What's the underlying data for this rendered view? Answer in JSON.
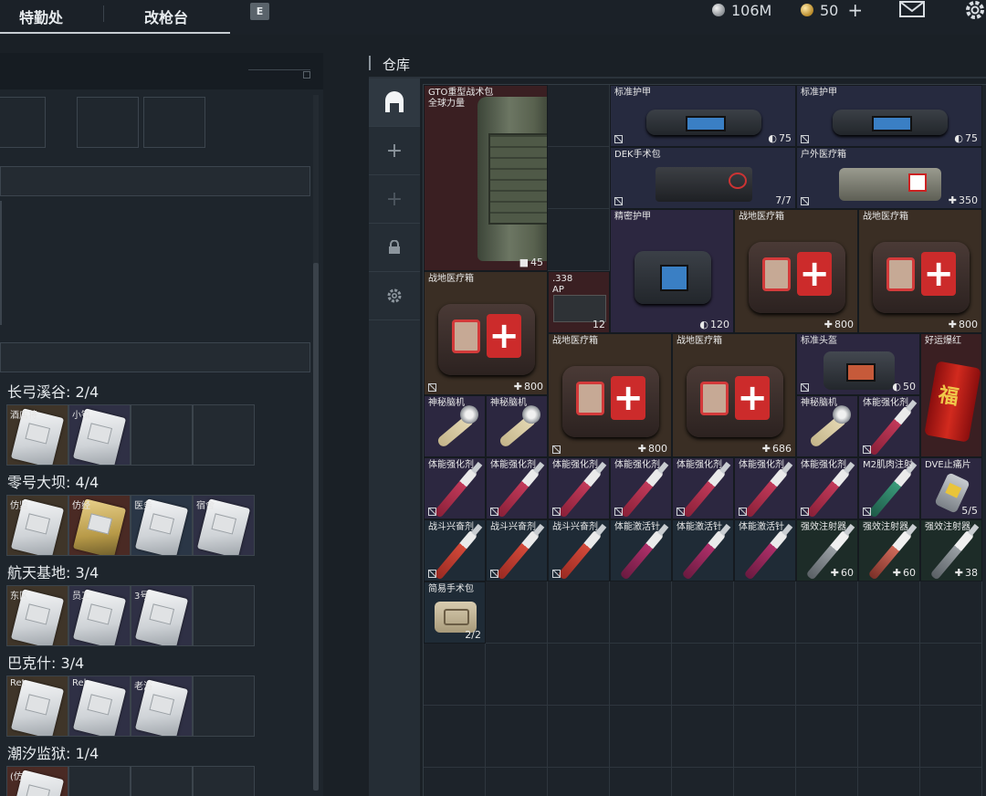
{
  "topbar": {
    "tabs": [
      "特勤处",
      "改枪台"
    ],
    "key_hint": "E",
    "silver_amount": "106M",
    "gold_amount": "50",
    "add_symbol": "+"
  },
  "left_panel": {
    "maps": [
      {
        "title": "长弓溪谷: 2/4",
        "cards": [
          {
            "label": "酒店将",
            "color": "brown",
            "owned": true
          },
          {
            "label": "小镇",
            "color": "purple",
            "owned": true
          },
          {
            "label": "",
            "color": "empty",
            "owned": false
          },
          {
            "label": "",
            "color": "empty",
            "owned": false
          }
        ]
      },
      {
        "title": "零号大坝: 4/4",
        "cards": [
          {
            "label": "仿监",
            "color": "brown",
            "owned": true
          },
          {
            "label": "仿经",
            "color": "red",
            "owned": true,
            "gold": true
          },
          {
            "label": "医务",
            "color": "blue",
            "owned": true
          },
          {
            "label": "宿舍",
            "color": "purple",
            "owned": true
          }
        ]
      },
      {
        "title": "航天基地: 3/4",
        "cards": [
          {
            "label": "东区",
            "color": "brown",
            "owned": true
          },
          {
            "label": "员工",
            "color": "purple",
            "owned": true
          },
          {
            "label": "3号",
            "color": "purple",
            "owned": true
          },
          {
            "label": "",
            "color": "empty",
            "owned": false
          }
        ]
      },
      {
        "title": "巴克什: 3/4",
        "cards": [
          {
            "label": "Ret",
            "color": "brown",
            "owned": true
          },
          {
            "label": "Rel",
            "color": "purple",
            "owned": true
          },
          {
            "label": "老浴",
            "color": "purple",
            "owned": true
          },
          {
            "label": "",
            "color": "empty",
            "owned": false
          }
        ]
      },
      {
        "title": "潮汐监狱: 1/4",
        "cards": [
          {
            "label": "(仿",
            "color": "red",
            "owned": true
          },
          {
            "label": "",
            "color": "empty",
            "owned": false
          },
          {
            "label": "",
            "color": "empty",
            "owned": false
          },
          {
            "label": "",
            "color": "empty",
            "owned": false
          }
        ]
      }
    ]
  },
  "warehouse": {
    "title": "仓库",
    "sidebar": [
      {
        "icon": "warehouse-icon",
        "symbol": ""
      },
      {
        "icon": "add-icon",
        "symbol": "+"
      },
      {
        "icon": "add-disabled-icon",
        "symbol": "+"
      },
      {
        "icon": "lock-icon",
        "symbol": ""
      },
      {
        "icon": "settings-icon",
        "symbol": ""
      }
    ],
    "items": [
      {
        "name": "GTO重型战术包\n全球力量",
        "value": "45",
        "sym": "bag",
        "color": "red",
        "art": "backpack",
        "c": 0,
        "r": 0,
        "w": 2,
        "h": 3
      },
      {
        "name": "标准护甲",
        "value": "75",
        "sym": "shield",
        "color": "blue",
        "art": "armor",
        "c": 3,
        "r": 0,
        "w": 3,
        "h": 1,
        "flag": true
      },
      {
        "name": "标准护甲",
        "value": "75",
        "sym": "shield",
        "color": "blue",
        "art": "armor",
        "c": 6,
        "r": 0,
        "w": 3,
        "h": 1,
        "flag": true
      },
      {
        "name": "DEK手术包",
        "value": "7/7",
        "sym": "",
        "color": "blue",
        "art": "dekkit",
        "c": 3,
        "r": 1,
        "w": 3,
        "h": 1,
        "flag": true
      },
      {
        "name": "户外医疗箱",
        "value": "350",
        "sym": "plus",
        "color": "blue",
        "art": "pouch",
        "c": 6,
        "r": 1,
        "w": 3,
        "h": 1,
        "flag": true
      },
      {
        "name": "精密护甲",
        "value": "120",
        "sym": "shield",
        "color": "purple",
        "art": "armor",
        "c": 3,
        "r": 2,
        "w": 2,
        "h": 2
      },
      {
        "name": "战地医疗箱",
        "value": "800",
        "sym": "plus",
        "color": "brown",
        "art": "medbox",
        "c": 5,
        "r": 2,
        "w": 2,
        "h": 2
      },
      {
        "name": "战地医疗箱",
        "value": "800",
        "sym": "plus",
        "color": "brown",
        "art": "medbox",
        "c": 7,
        "r": 2,
        "w": 2,
        "h": 2
      },
      {
        "name": "战地医疗箱",
        "value": "800",
        "sym": "plus",
        "color": "brown",
        "art": "medbox",
        "c": 0,
        "r": 3,
        "w": 2,
        "h": 2,
        "flag": true
      },
      {
        "name": ".338\nAP",
        "value": "12",
        "sym": "",
        "color": "red",
        "art": "ammo",
        "c": 2,
        "r": 3,
        "w": 1,
        "h": 1
      },
      {
        "name": "战地医疗箱",
        "value": "800",
        "sym": "plus",
        "color": "brown",
        "art": "medbox",
        "c": 2,
        "r": 4,
        "w": 2,
        "h": 2,
        "flag": true
      },
      {
        "name": "战地医疗箱",
        "value": "686",
        "sym": "plus",
        "color": "brown",
        "art": "medbox",
        "c": 4,
        "r": 4,
        "w": 2,
        "h": 2
      },
      {
        "name": "标准头盔",
        "value": "50",
        "sym": "shield",
        "color": "purple",
        "art": "helmetbag",
        "c": 6,
        "r": 4,
        "w": 2,
        "h": 1,
        "flag": true
      },
      {
        "name": "好运爆红",
        "value": "",
        "sym": "",
        "color": "red",
        "art": "firecracker",
        "c": 8,
        "r": 4,
        "w": 1,
        "h": 2
      },
      {
        "name": "神秘脑机",
        "value": "",
        "sym": "",
        "color": "purple",
        "art": "brainhook",
        "c": 0,
        "r": 5,
        "w": 1,
        "h": 1
      },
      {
        "name": "神秘脑机",
        "value": "",
        "sym": "",
        "color": "purple",
        "art": "brainhook",
        "c": 1,
        "r": 5,
        "w": 1,
        "h": 1
      },
      {
        "name": "神秘脑机",
        "value": "",
        "sym": "",
        "color": "purple",
        "art": "brainhook",
        "c": 6,
        "r": 5,
        "w": 1,
        "h": 1
      },
      {
        "name": "体能强化剂",
        "value": "",
        "sym": "",
        "color": "purple",
        "art": "syr-pink",
        "c": 7,
        "r": 5,
        "w": 1,
        "h": 1,
        "flag": true
      },
      {
        "name": "体能强化剂",
        "value": "",
        "sym": "",
        "color": "purple",
        "art": "syr-pink",
        "c": 0,
        "r": 6,
        "w": 1,
        "h": 1,
        "flag": true
      },
      {
        "name": "体能强化剂",
        "value": "",
        "sym": "",
        "color": "purple",
        "art": "syr-pink",
        "c": 1,
        "r": 6,
        "w": 1,
        "h": 1,
        "flag": true
      },
      {
        "name": "体能强化剂",
        "value": "",
        "sym": "",
        "color": "purple",
        "art": "syr-pink",
        "c": 2,
        "r": 6,
        "w": 1,
        "h": 1,
        "flag": true
      },
      {
        "name": "体能强化剂",
        "value": "",
        "sym": "",
        "color": "purple",
        "art": "syr-pink",
        "c": 3,
        "r": 6,
        "w": 1,
        "h": 1,
        "flag": true
      },
      {
        "name": "体能强化剂",
        "value": "",
        "sym": "",
        "color": "purple",
        "art": "syr-pink",
        "c": 4,
        "r": 6,
        "w": 1,
        "h": 1,
        "flag": true
      },
      {
        "name": "体能强化剂",
        "value": "",
        "sym": "",
        "color": "purple",
        "art": "syr-pink",
        "c": 5,
        "r": 6,
        "w": 1,
        "h": 1,
        "flag": true
      },
      {
        "name": "体能强化剂",
        "value": "",
        "sym": "",
        "color": "purple",
        "art": "syr-pink",
        "c": 6,
        "r": 6,
        "w": 1,
        "h": 1,
        "flag": true
      },
      {
        "name": "M2肌肉注射",
        "value": "",
        "sym": "",
        "color": "purple",
        "art": "syr-green",
        "c": 7,
        "r": 6,
        "w": 1,
        "h": 1,
        "flag": true
      },
      {
        "name": "DVE止痛片",
        "value": "5/5",
        "sym": "",
        "color": "purple",
        "art": "inhaler",
        "c": 8,
        "r": 6,
        "w": 1,
        "h": 1
      },
      {
        "name": "战斗兴奋剂",
        "value": "",
        "sym": "",
        "color": "teal",
        "art": "syr-red",
        "c": 0,
        "r": 7,
        "w": 1,
        "h": 1,
        "flag": true
      },
      {
        "name": "战斗兴奋剂",
        "value": "",
        "sym": "",
        "color": "teal",
        "art": "syr-red",
        "c": 1,
        "r": 7,
        "w": 1,
        "h": 1,
        "flag": true
      },
      {
        "name": "战斗兴奋剂",
        "value": "",
        "sym": "",
        "color": "teal",
        "art": "syr-red",
        "c": 2,
        "r": 7,
        "w": 1,
        "h": 1,
        "flag": true
      },
      {
        "name": "体能激活针",
        "value": "",
        "sym": "",
        "color": "teal",
        "art": "syr-mag",
        "c": 3,
        "r": 7,
        "w": 1,
        "h": 1
      },
      {
        "name": "体能激活针",
        "value": "",
        "sym": "",
        "color": "teal",
        "art": "syr-mag",
        "c": 4,
        "r": 7,
        "w": 1,
        "h": 1
      },
      {
        "name": "体能激活针",
        "value": "",
        "sym": "",
        "color": "teal",
        "art": "syr-mag",
        "c": 5,
        "r": 7,
        "w": 1,
        "h": 1
      },
      {
        "name": "强效注射器",
        "value": "60",
        "sym": "plus",
        "color": "green",
        "art": "syr-grey",
        "c": 6,
        "r": 7,
        "w": 1,
        "h": 1
      },
      {
        "name": "强效注射器",
        "value": "60",
        "sym": "plus",
        "color": "green",
        "art": "syr-salmon",
        "c": 7,
        "r": 7,
        "w": 1,
        "h": 1
      },
      {
        "name": "强效注射器",
        "value": "38",
        "sym": "plus",
        "color": "green",
        "art": "syr-grey",
        "c": 8,
        "r": 7,
        "w": 1,
        "h": 1
      },
      {
        "name": "简易手术包",
        "value": "2/2",
        "sym": "",
        "color": "teal",
        "art": "surgkit",
        "c": 0,
        "r": 8,
        "w": 1,
        "h": 1
      }
    ]
  }
}
